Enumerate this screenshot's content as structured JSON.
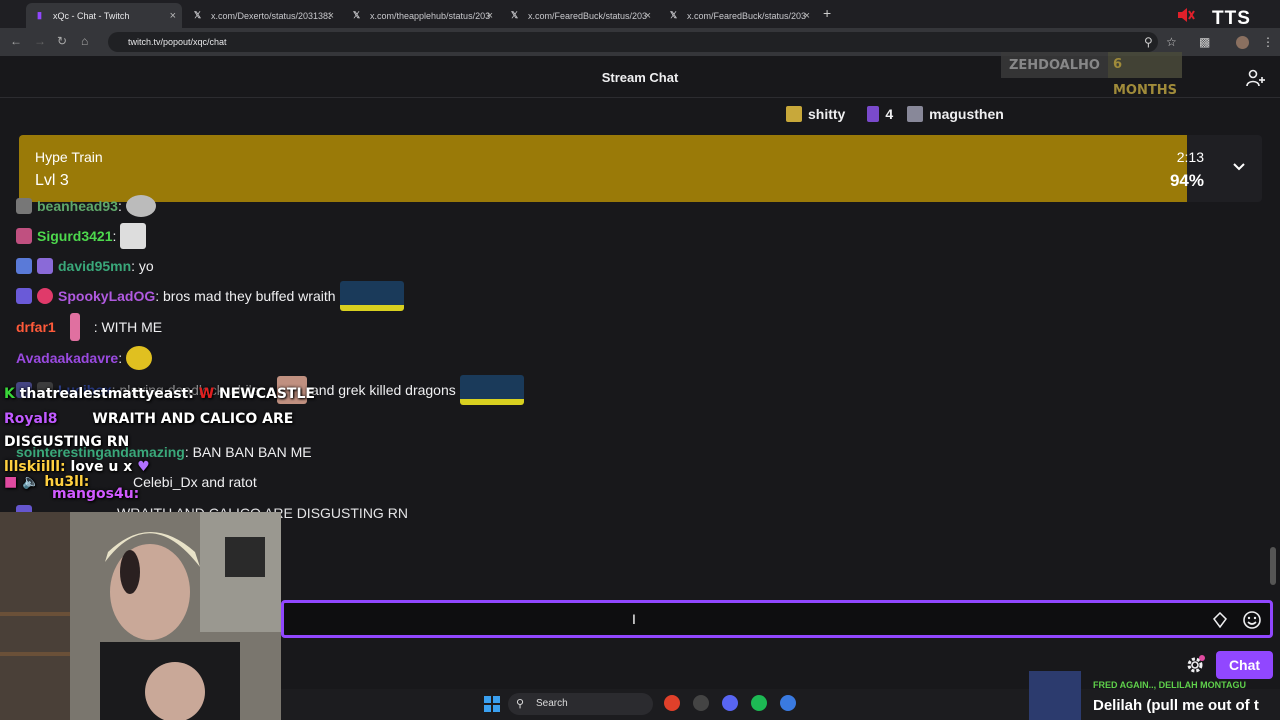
{
  "browser": {
    "tabs": [
      {
        "title": "xQc - Chat - Twitch",
        "active": true,
        "icon": "twitch-icon"
      },
      {
        "title": "x.com/Dexerto/status/2031383",
        "active": false,
        "icon": "x-icon"
      },
      {
        "title": "x.com/theapplehub/status/203",
        "active": false,
        "icon": "x-icon"
      },
      {
        "title": "x.com/FearedBuck/status/203",
        "active": false,
        "icon": "x-icon"
      },
      {
        "title": "x.com/FearedBuck/status/203",
        "active": false,
        "icon": "x-icon"
      }
    ],
    "url": "twitch.tv/popout/xqc/chat",
    "tts_label": "TTS"
  },
  "chat": {
    "title": "Stream Chat",
    "sub_badge": {
      "name": "ZEHDOALHO",
      "months": "6 MONTHS"
    },
    "gift_leaderboard": [
      {
        "name": "shitty",
        "color": "#c8a83a"
      },
      {
        "name": "4",
        "color": "#9a5cff"
      },
      {
        "name": "magusthen",
        "color": "#9aa"
      }
    ],
    "hype_train": {
      "label": "Hype Train",
      "level": "Lvl 3",
      "time": "2:13",
      "percent_text": "94%",
      "percent": 0.94
    },
    "messages": [
      {
        "user": "beanhead93",
        "color": "#5fa86a",
        "text": ":",
        "badges": [
          "#777"
        ]
      },
      {
        "user": "Sigurd3421",
        "color": "#4dd84d",
        "text": ":",
        "badges": [
          "#c05080"
        ]
      },
      {
        "user": "david95mn",
        "color": "#3aa87a",
        "text": ": yo",
        "badges": [
          "#5a7ad8",
          "#8a6ad8"
        ]
      },
      {
        "user": "SpookyLadOG",
        "color": "#b05ae0",
        "text": ": bros mad they buffed wraith",
        "badges": [
          "#6a5ad8",
          "#e03a6a"
        ]
      },
      {
        "user": "drfar1",
        "color": "#ff5a3a",
        "text": ": WITH ME",
        "badges": []
      },
      {
        "user": "Avadaakadavre",
        "color": "#9a4ae0",
        "text": ":",
        "badges": []
      },
      {
        "user": "Lucibox",
        "color": "#3a5ae0",
        "text": ": playing deadlock while",
        "badges": [
          "#6a6ad8",
          "#5a5a5a"
        ]
      },
      {
        "user": "",
        "color": "#efeff1",
        "text": "and grek killed dragons",
        "badges": []
      },
      {
        "user": "sointerestingandamazing",
        "color": "#3aa87a",
        "text": ": BAN BAN BAN ME",
        "badges": []
      },
      {
        "user": "",
        "color": "#efeff1",
        "text": "Celebi_Dx and ratot",
        "badges": []
      },
      {
        "user": "",
        "color": "#efeff1",
        "text": "WRAITH AND CALICO ARE DISGUSTING RN",
        "badges": []
      }
    ],
    "input": {
      "placeholder": ""
    },
    "chat_button": "Chat"
  },
  "overlay": {
    "messages": [
      {
        "user": "thatrealestmattyeast:",
        "color": "#fff",
        "text": "NEWCASTLE"
      },
      {
        "user": "Royal8",
        "color": "#c05aff",
        "text": "WRAITH AND CALICO ARE"
      },
      {
        "user": "",
        "color": "#fff",
        "text": "DISGUSTING RN"
      },
      {
        "user": "lllskiilll:",
        "color": "#ffd040",
        "text": "love u x"
      },
      {
        "user": "hu3ll:",
        "color": "#ffd040",
        "text": ""
      },
      {
        "user": "mangos4u:",
        "color": "#d05aff",
        "text": ""
      }
    ]
  },
  "taskbar": {
    "search": "Search"
  },
  "now_playing": {
    "artist": "FRED AGAIN.., DELILAH MONTAGU",
    "title": "Delilah (pull me out of t"
  }
}
